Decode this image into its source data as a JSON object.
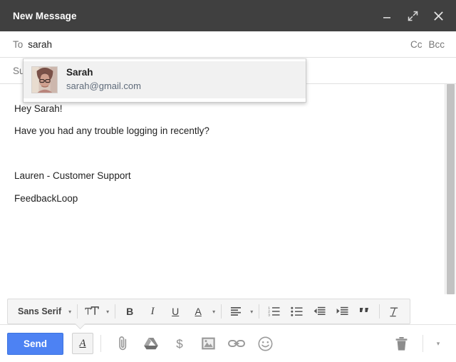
{
  "window": {
    "title": "New Message",
    "controls": [
      {
        "name": "minimize",
        "icon": "minimize-icon"
      },
      {
        "name": "expand",
        "icon": "expand-icon"
      },
      {
        "name": "close",
        "icon": "close-icon"
      }
    ]
  },
  "fields": {
    "to_label": "To",
    "to_value": "sarah",
    "cc_label": "Cc",
    "bcc_label": "Bcc",
    "subject_label": "Su",
    "subject_value": ""
  },
  "autocomplete": {
    "visible": true,
    "contact_name": "Sarah",
    "contact_email": "sarah@gmail.com",
    "avatar": "contact-photo"
  },
  "body": {
    "lines": [
      "Hey Sarah!",
      "Have you had any trouble logging in recently?",
      "",
      "Lauren - Customer Support",
      "FeedbackLoop"
    ]
  },
  "format_toolbar": {
    "font_family": "Sans Serif",
    "font_caret": "▾",
    "size_icon": "font-size-icon",
    "size_caret": "▾",
    "bold": "B",
    "italic": "I",
    "underline": "U",
    "text_color": "A",
    "color_caret": "▾",
    "align_icon": "align-left-icon",
    "align_caret": "▾",
    "numbered_list": "numbered-list-icon",
    "bulleted_list": "bulleted-list-icon",
    "indent_less": "indent-less-icon",
    "indent_more": "indent-more-icon",
    "quote": "””",
    "remove_format": "remove-formatting-icon"
  },
  "bottom_bar": {
    "send_label": "Send",
    "format_toggle": "A",
    "attach": "paperclip-icon",
    "drive": "google-drive-icon",
    "money": "$",
    "photo": "insert-photo-icon",
    "link": "insert-link-icon",
    "emoji": "emoji-icon",
    "discard": "trash-icon",
    "more": "▾"
  },
  "colors": {
    "titlebar_bg": "#404040",
    "send_blue": "#4d82f3",
    "border_gray": "#e0e0e0",
    "label_gray": "#777777",
    "email_blue_gray": "#5f6b7a",
    "icon_gray": "#9b9b9b"
  }
}
